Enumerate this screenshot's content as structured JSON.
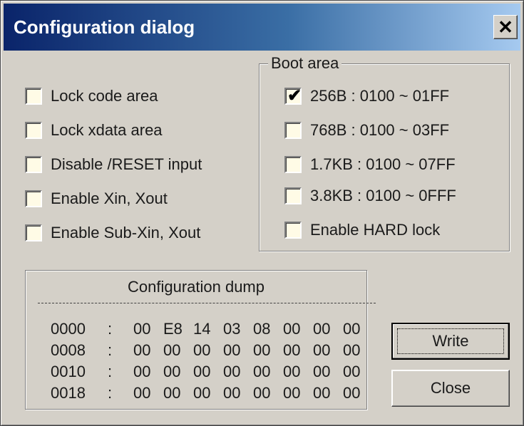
{
  "window": {
    "title": "Configuration dialog",
    "close_label": "✕"
  },
  "options": [
    {
      "label": "Lock code area",
      "checked": false
    },
    {
      "label": "Lock xdata area",
      "checked": false
    },
    {
      "label": "Disable /RESET input",
      "checked": false
    },
    {
      "label": "Enable Xin, Xout",
      "checked": false
    },
    {
      "label": "Enable Sub-Xin, Xout",
      "checked": false
    }
  ],
  "boot_area": {
    "legend": "Boot area",
    "items": [
      {
        "label": "256B : 0100 ~ 01FF",
        "checked": true
      },
      {
        "label": "768B : 0100 ~ 03FF",
        "checked": false
      },
      {
        "label": "1.7KB : 0100 ~ 07FF",
        "checked": false
      },
      {
        "label": "3.8KB : 0100 ~ 0FFF",
        "checked": false
      },
      {
        "label": "Enable HARD lock",
        "checked": false
      }
    ]
  },
  "dump": {
    "title": "Configuration dump",
    "rows": [
      {
        "addr": "0000",
        "bytes": [
          "00",
          "E8",
          "14",
          "03",
          "08",
          "00",
          "00",
          "00"
        ]
      },
      {
        "addr": "0008",
        "bytes": [
          "00",
          "00",
          "00",
          "00",
          "00",
          "00",
          "00",
          "00"
        ]
      },
      {
        "addr": "0010",
        "bytes": [
          "00",
          "00",
          "00",
          "00",
          "00",
          "00",
          "00",
          "00"
        ]
      },
      {
        "addr": "0018",
        "bytes": [
          "00",
          "00",
          "00",
          "00",
          "00",
          "00",
          "00",
          "00"
        ]
      }
    ]
  },
  "buttons": {
    "write": "Write",
    "close": "Close"
  }
}
